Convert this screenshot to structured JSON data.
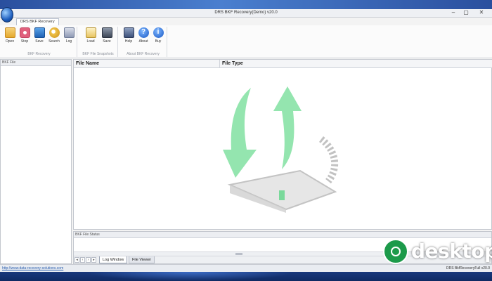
{
  "window": {
    "title": "DRS BKF Recovery(Demo) v20.0"
  },
  "ribbon": {
    "tab": "DRS BKF Recovery",
    "groups": [
      {
        "label": "BKF Recovery",
        "buttons": [
          "Open",
          "Stop",
          "Save",
          "Search",
          "Log"
        ]
      },
      {
        "label": "BKF File Snapshots",
        "buttons": [
          "Load",
          "Save"
        ]
      },
      {
        "label": "About BKF Recovery",
        "buttons": [
          "Help",
          "About",
          "Buy"
        ]
      }
    ]
  },
  "left_panel": {
    "header": "BKF File"
  },
  "main": {
    "columns": [
      "File Name",
      "File Type"
    ]
  },
  "status_panel": {
    "header": "BKF File Status"
  },
  "bottom_tabs": [
    "Log Window",
    "File Viewer"
  ],
  "statusbar": {
    "url": "http://www.data-recovery-solutions.com",
    "version": "DRS BkfRecoveryFull v20.0"
  },
  "overlay": {
    "brand": "desktop"
  },
  "colors": {
    "accent_green": "#1c9a4a",
    "title_blue": "#1f5fbf"
  }
}
